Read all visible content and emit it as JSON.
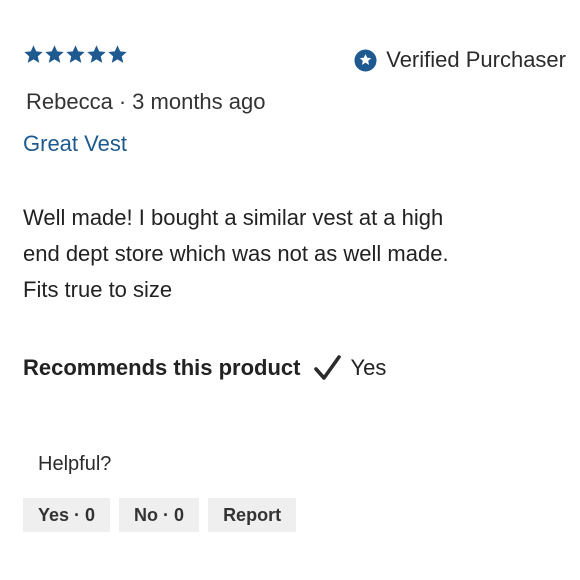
{
  "review": {
    "rating": 5,
    "rating_max": 5,
    "star_color": "#1e5a8f",
    "verified_label": "Verified Purchaser",
    "author": "Rebecca",
    "separator": "·",
    "time_ago": "3 months ago",
    "title": "Great Vest",
    "body_lines": [
      "Well made! I bought a similar vest at a high",
      "end dept store which was not as well made.",
      "Fits true to size"
    ],
    "recommend_label": "Recommends this product",
    "recommend_value": "Yes"
  },
  "feedback": {
    "helpful_label": "Helpful?",
    "yes_label": "Yes · 0",
    "no_label": "No · 0",
    "report_label": "Report"
  },
  "icons": {
    "star": "star-icon",
    "verified": "star-in-circle-icon",
    "check": "checkmark-icon"
  }
}
